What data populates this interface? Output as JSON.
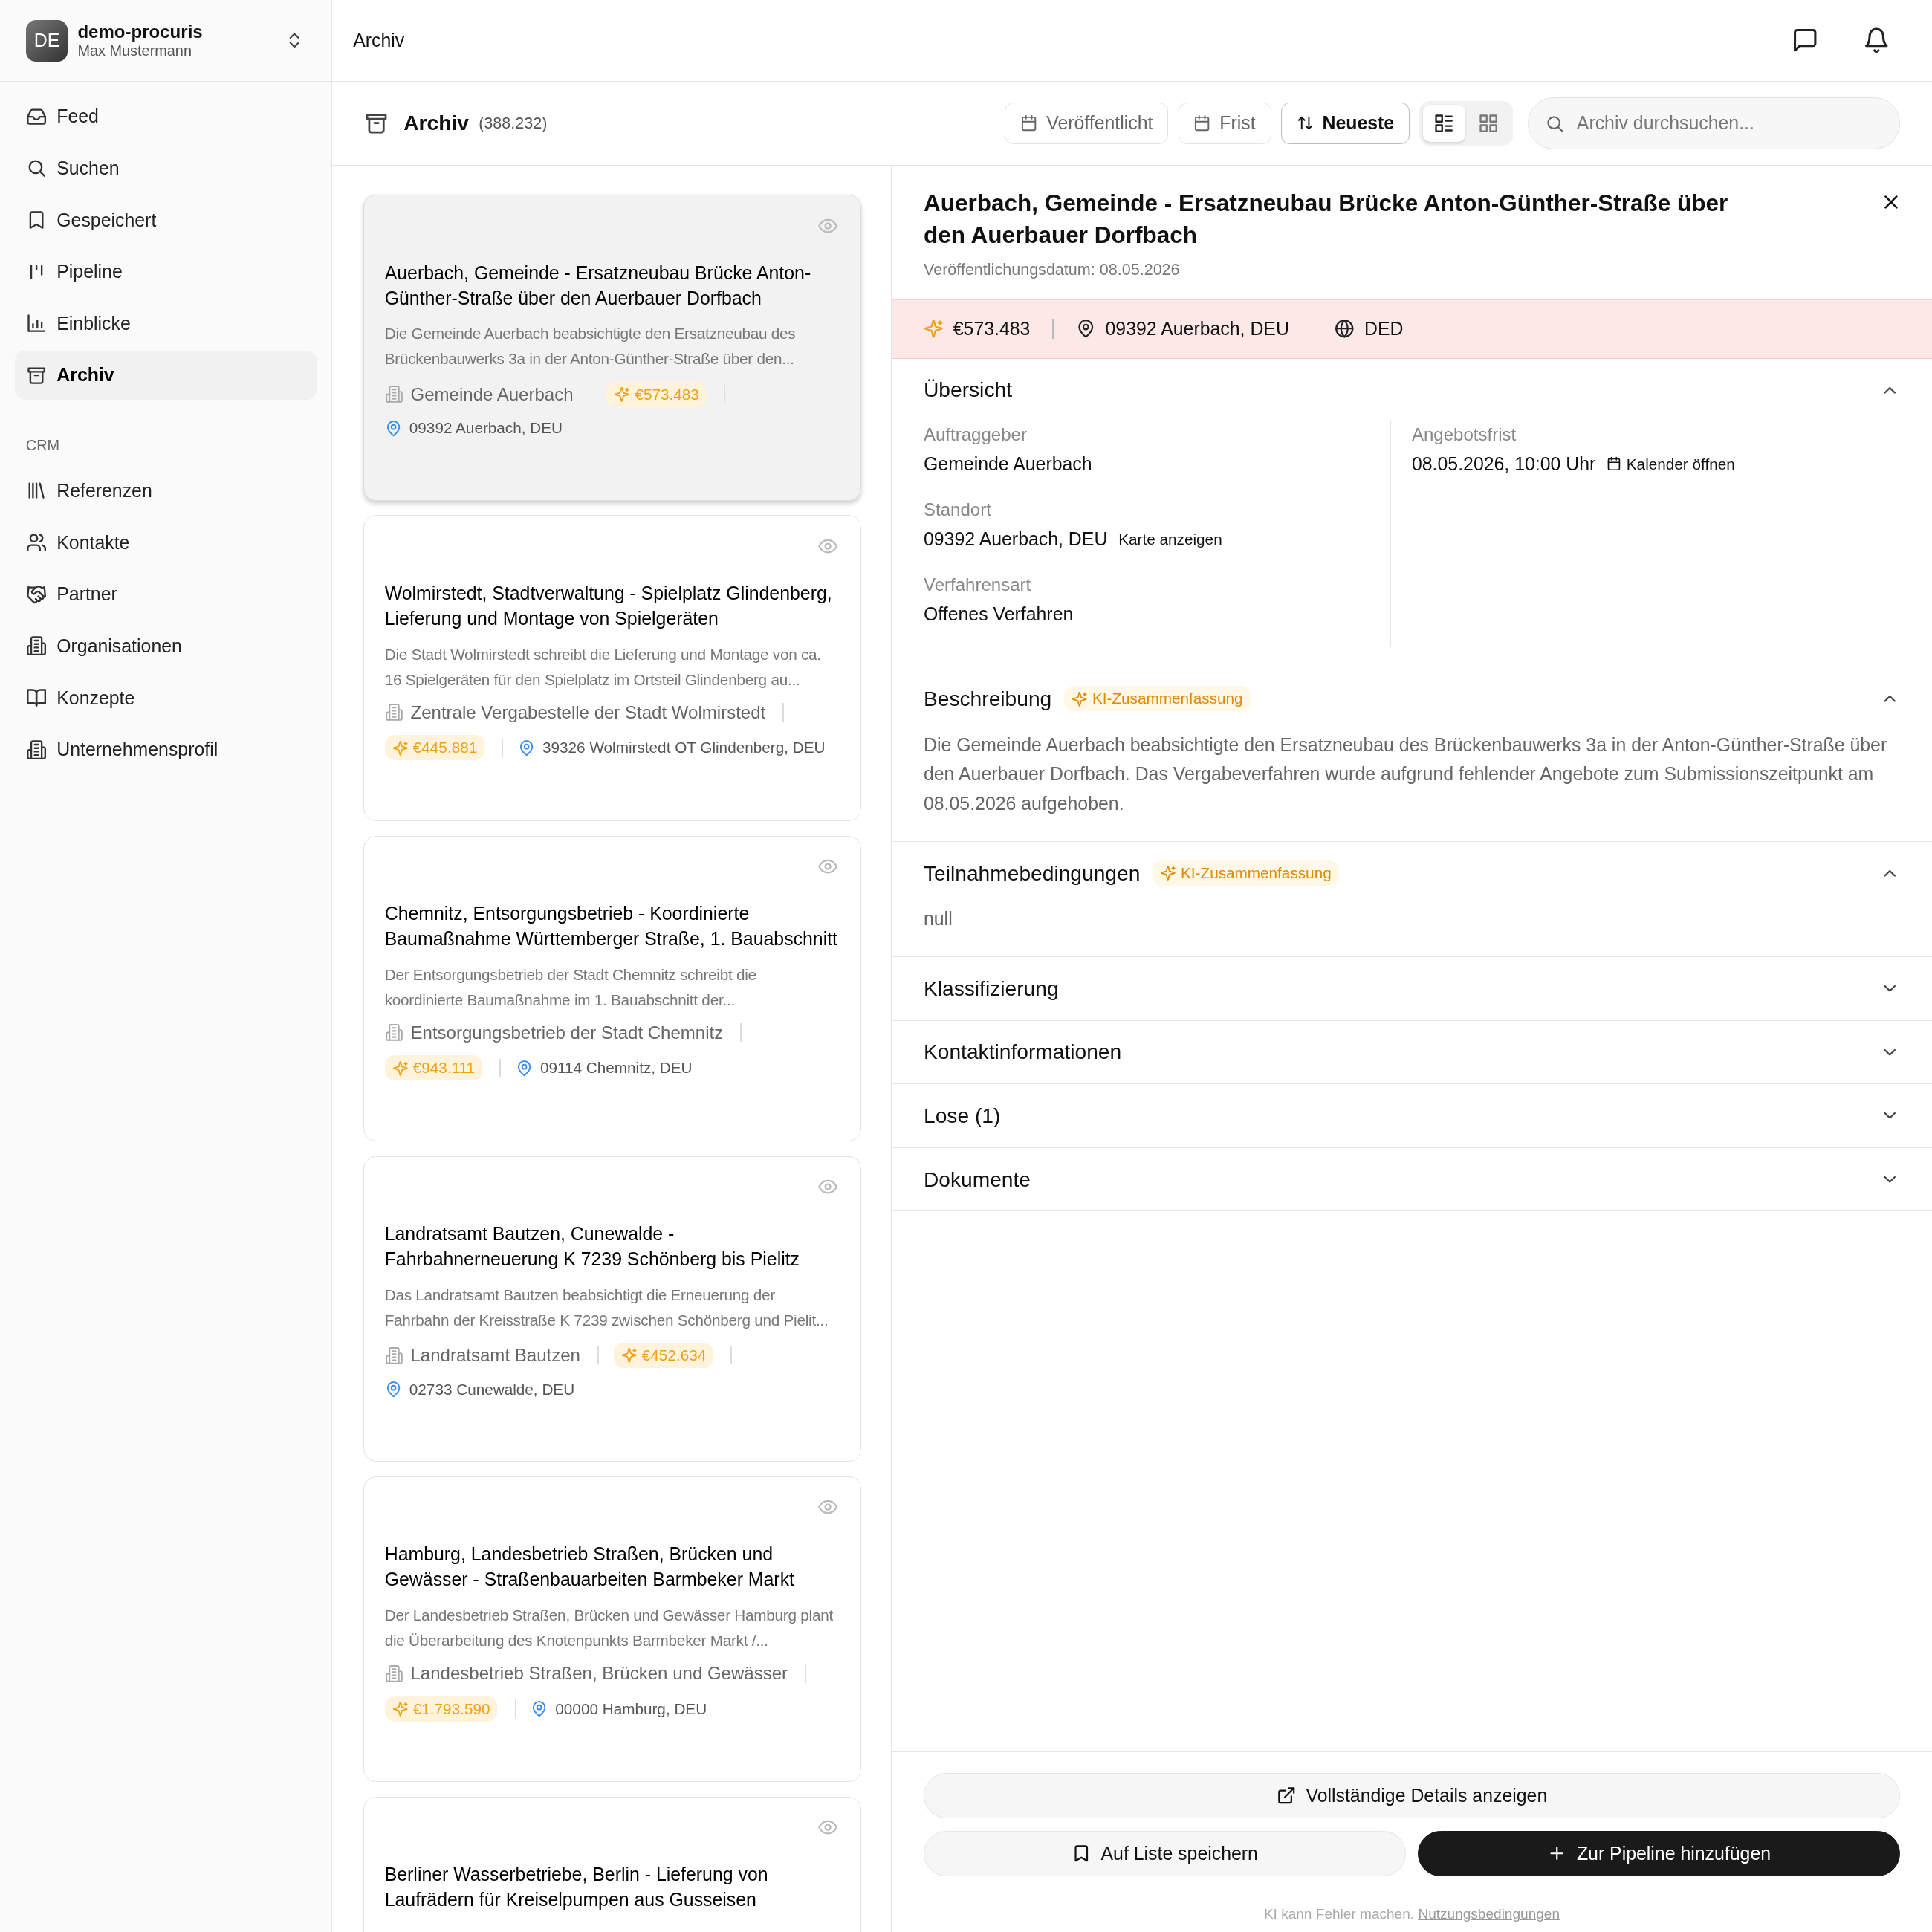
{
  "sidebar": {
    "workspace": {
      "initials": "DE",
      "name": "demo-procuris",
      "user": "Max Mustermann"
    },
    "items": [
      {
        "label": "Feed",
        "selected": false
      },
      {
        "label": "Suchen",
        "selected": false
      },
      {
        "label": "Gespeichert",
        "selected": false
      },
      {
        "label": "Pipeline",
        "selected": false
      },
      {
        "label": "Einblicke",
        "selected": false
      },
      {
        "label": "Archiv",
        "selected": true
      }
    ],
    "section_label": "CRM",
    "crm_items": [
      {
        "label": "Referenzen",
        "selected": false
      },
      {
        "label": "Kontakte",
        "selected": false
      },
      {
        "label": "Partner",
        "selected": false
      },
      {
        "label": "Organisationen",
        "selected": false
      },
      {
        "label": "Konzepte",
        "selected": false
      },
      {
        "label": "Unternehmensprofil",
        "selected": false
      }
    ]
  },
  "topbar": {
    "breadcrumb": "Archiv"
  },
  "header": {
    "title": "Archiv",
    "count": "(388.232)",
    "filters": [
      "Veröffentlicht",
      "Frist"
    ],
    "sort": "Neueste",
    "views": [
      {
        "selected": true
      },
      {
        "selected": false
      }
    ],
    "search": {
      "placeholder": "Archiv durchsuchen..."
    }
  },
  "cards": [
    {
      "selected": true,
      "title": "Auerbach, Gemeinde - Ersatzneubau Brücke Anton-Günther-Straße über den Auerbauer Dorfbach",
      "description": "Die Gemeinde Auerbach beabsichtigte den Ersatzneubau des Brückenbauwerks 3a in der Anton-Günther-Straße über den...",
      "organization": "Gemeinde Auerbach",
      "value": "€573.483",
      "location": "09392 Auerbach, DEU"
    },
    {
      "selected": false,
      "title": "Wolmirstedt, Stadtverwaltung - Spielplatz Glindenberg, Lieferung und Montage von Spielgeräten",
      "description": "Die Stadt Wolmirstedt schreibt die Lieferung und Montage von ca. 16 Spielgeräten für den Spielplatz im Ortsteil Glindenberg au...",
      "organization": "Zentrale Vergabestelle der Stadt Wolmirstedt",
      "value": "€445.881",
      "location": "39326 Wolmirstedt OT Glindenberg, DEU"
    },
    {
      "selected": false,
      "title": "Chemnitz, Entsorgungsbetrieb - Koordinierte Baumaßnahme Württemberger Straße, 1. Bauabschnitt",
      "description": "Der Entsorgungsbetrieb der Stadt Chemnitz schreibt die koordinierte Baumaßnahme im 1. Bauabschnitt der...",
      "organization": "Entsorgungsbetrieb der Stadt Chemnitz",
      "value": "€943.111",
      "location": "09114 Chemnitz, DEU"
    },
    {
      "selected": false,
      "title": "Landratsamt Bautzen, Cunewalde - Fahrbahnerneuerung K 7239 Schönberg bis Pielitz",
      "description": "Das Landratsamt Bautzen beabsichtigt die Erneuerung der Fahrbahn der Kreisstraße K 7239 zwischen Schönberg und Pielit...",
      "organization": "Landratsamt Bautzen",
      "value": "€452.634",
      "location": "02733 Cunewalde, DEU"
    },
    {
      "selected": false,
      "title": "Hamburg, Landesbetrieb Straßen, Brücken und Gewässer - Straßenbauarbeiten Barmbeker Markt",
      "description": "Der Landesbetrieb Straßen, Brücken und Gewässer Hamburg plant die Überarbeitung des Knotenpunkts Barmbeker Markt /...",
      "organization": "Landesbetrieb Straßen, Brücken und Gewässer",
      "value": "€1.793.590",
      "location": "00000 Hamburg, DEU"
    },
    {
      "selected": false,
      "title": "Berliner Wasserbetriebe, Berlin - Lieferung von Laufrädern für Kreiselpumpen aus Gusseisen"
    }
  ],
  "detail": {
    "title": "Auerbach, Gemeinde - Ersatzneubau Brücke Anton-Günther-Straße über den Auerbauer Dorfbach",
    "date": "Veröffentlichungsdatum: 08.05.2026",
    "band": {
      "value": "€573.483",
      "location": "09392 Auerbach, DEU",
      "region": "DED"
    },
    "sections": [
      {
        "kind": "overview",
        "title": "Übersicht",
        "expanded": true,
        "left": [
          {
            "label": "Auftraggeber",
            "value": "Gemeinde Auerbach"
          },
          {
            "label": "Standort",
            "value": "09392 Auerbach, DEU",
            "link": {
              "label": "Karte anzeigen"
            }
          },
          {
            "label": "Verfahrensart",
            "value": "Offenes Verfahren"
          }
        ],
        "right": [
          {
            "label": "Angebotsfrist",
            "value": "08.05.2026, 10:00 Uhr",
            "link": {
              "kind": "calendar",
              "label": "Kalender öffnen"
            }
          }
        ]
      },
      {
        "kind": "text",
        "title": "Beschreibung",
        "badge": "KI-Zusammenfassung",
        "expanded": true,
        "text": "Die Gemeinde Auerbach beabsichtigte den Ersatzneubau des Brückenbauwerks 3a in der Anton-Günther-Straße über den Auerbauer Dorfbach. Das Vergabeverfahren wurde aufgrund fehlender Angebote zum Submissionszeitpunkt am 08.05.2026 aufgehoben."
      },
      {
        "kind": "text",
        "title": "Teilnahmebedingungen",
        "badge": "KI-Zusammenfassung",
        "expanded": true,
        "text": "null"
      },
      {
        "title": "Klassifizierung",
        "expanded": false
      },
      {
        "title": "Kontaktinformationen",
        "expanded": false
      },
      {
        "title": "Lose (1)",
        "expanded": false
      },
      {
        "title": "Dokumente",
        "expanded": false
      }
    ],
    "actions": {
      "details": "Vollständige Details anzeigen",
      "save": "Auf Liste speichern",
      "pipeline": "Zur Pipeline hinzufügen"
    },
    "disclaimer": {
      "text": "KI kann Fehler machen.",
      "link": "Nutzungsbedingungen"
    }
  }
}
